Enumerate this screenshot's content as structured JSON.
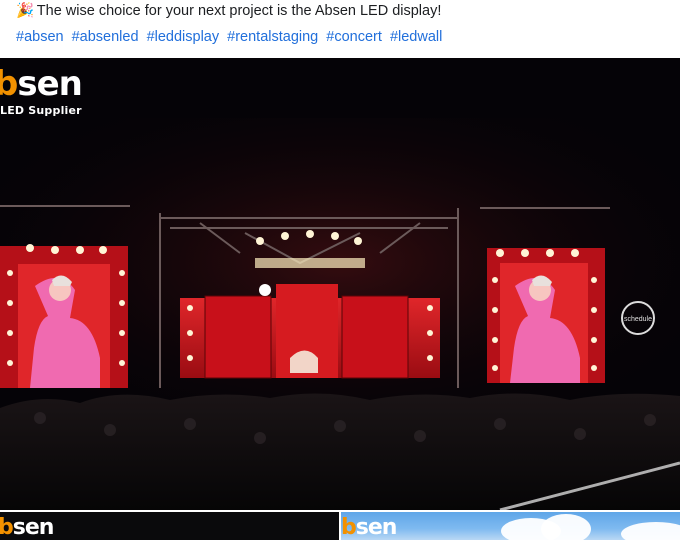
{
  "post": {
    "emoji_icon": "party-popper-icon",
    "text": "The wise choice for your next project is the Absen LED display!",
    "hashtags": [
      "#absen",
      "#absenled",
      "#leddisplay",
      "#rentalstaging",
      "#concert",
      "#ledwall"
    ]
  },
  "main_photo": {
    "logo_word_start": "b",
    "logo_word_end": "sen",
    "logo_tagline": "LED Supplier",
    "watermark": "schedule"
  },
  "thumbnails": [
    {
      "logo_start": "b",
      "logo_end": "sen"
    },
    {
      "logo_start": "b",
      "logo_end": "sen"
    }
  ],
  "colors": {
    "hashtag": "#216fdb",
    "logo_accent": "#f29100",
    "screen_red": "#c8101a",
    "screen_pink": "#f06ab0"
  }
}
